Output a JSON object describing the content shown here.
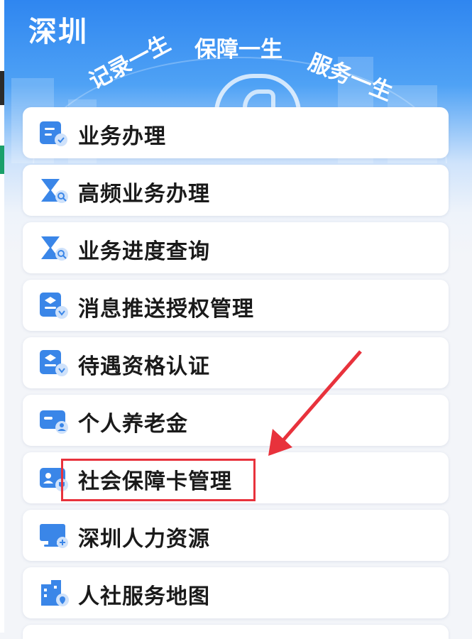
{
  "header": {
    "city": "深圳",
    "slogans": [
      "记录一生",
      "保障一生",
      "服务一生"
    ]
  },
  "menu": {
    "items": [
      {
        "label": "业务办理",
        "icon": "form-icon"
      },
      {
        "label": "高频业务办理",
        "icon": "hourglass-search-icon"
      },
      {
        "label": "业务进度查询",
        "icon": "hourglass-search-icon"
      },
      {
        "label": "消息推送授权管理",
        "icon": "user-card-check-icon"
      },
      {
        "label": "待遇资格认证",
        "icon": "user-card-check-icon"
      },
      {
        "label": "个人养老金",
        "icon": "wallet-card-icon"
      },
      {
        "label": "社会保障卡管理",
        "icon": "id-card-shield-icon"
      },
      {
        "label": "深圳人力资源",
        "icon": "monitor-icon"
      },
      {
        "label": "人社服务地图",
        "icon": "building-location-icon"
      }
    ]
  },
  "annotation": {
    "highlight_color": "#e8323c"
  },
  "colors": {
    "brand_blue": "#2f86f0",
    "icon_blue": "#3a86e8",
    "text": "#1a1a1a"
  }
}
